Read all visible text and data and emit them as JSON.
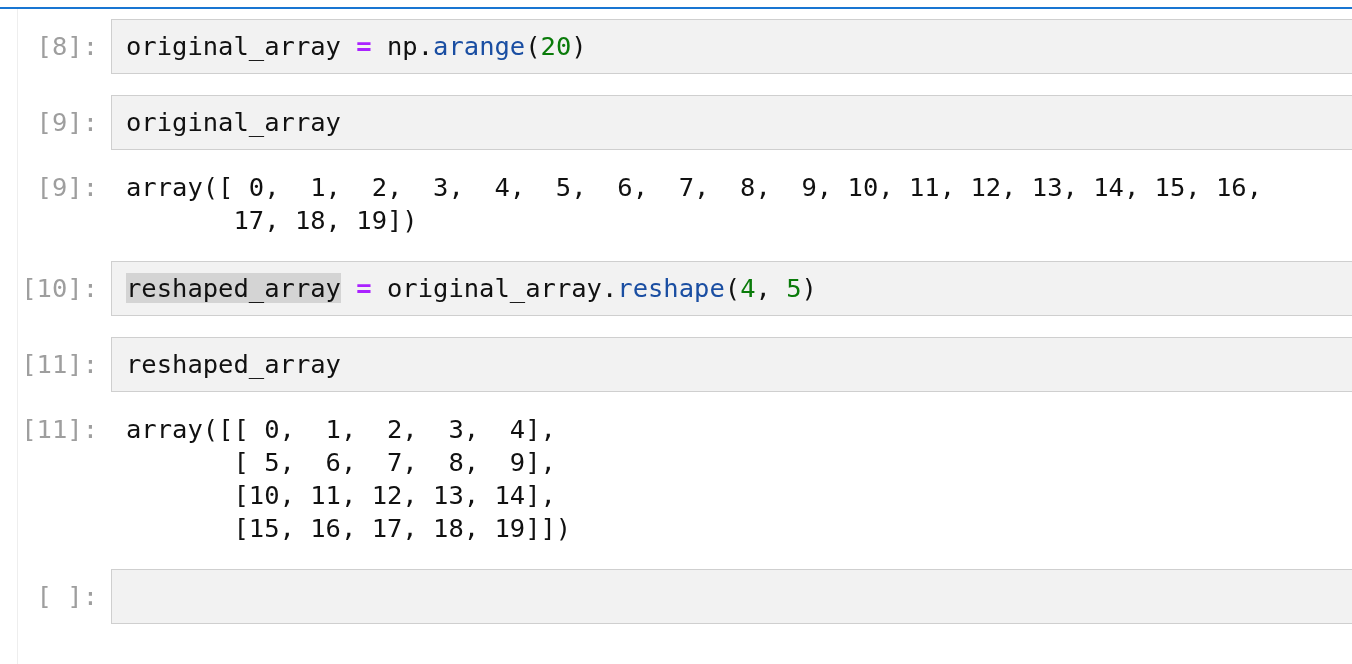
{
  "cells": [
    {
      "kind": "input",
      "prompt": "[8]:",
      "tokens": [
        {
          "text": "original_array",
          "kind": "name",
          "highlighted": false
        },
        {
          "text": " =",
          "kind": "op",
          "highlighted": false
        },
        {
          "text": " np.",
          "kind": "name",
          "highlighted": false
        },
        {
          "text": "arange",
          "kind": "func",
          "highlighted": false
        },
        {
          "text": "(",
          "kind": "name",
          "highlighted": false
        },
        {
          "text": "20",
          "kind": "num",
          "highlighted": false
        },
        {
          "text": ")",
          "kind": "name",
          "highlighted": false
        }
      ]
    },
    {
      "kind": "input",
      "prompt": "[9]:",
      "tokens": [
        {
          "text": "original_array",
          "kind": "name",
          "highlighted": false
        }
      ]
    },
    {
      "kind": "output",
      "prompt": "[9]:",
      "text": "array([ 0,  1,  2,  3,  4,  5,  6,  7,  8,  9, 10, 11, 12, 13, 14, 15, 16,\n       17, 18, 19])"
    },
    {
      "kind": "input",
      "prompt": "[10]:",
      "tokens": [
        {
          "text": "reshaped_array",
          "kind": "name",
          "highlighted": true
        },
        {
          "text": " =",
          "kind": "op",
          "highlighted": false
        },
        {
          "text": " original_array.",
          "kind": "name",
          "highlighted": false
        },
        {
          "text": "reshape",
          "kind": "func",
          "highlighted": false
        },
        {
          "text": "(",
          "kind": "name",
          "highlighted": false
        },
        {
          "text": "4",
          "kind": "num",
          "highlighted": false
        },
        {
          "text": ", ",
          "kind": "name",
          "highlighted": false
        },
        {
          "text": "5",
          "kind": "num",
          "highlighted": false
        },
        {
          "text": ")",
          "kind": "name",
          "highlighted": false
        }
      ]
    },
    {
      "kind": "input",
      "prompt": "[11]:",
      "tokens": [
        {
          "text": "reshaped_array",
          "kind": "name",
          "highlighted": false
        }
      ]
    },
    {
      "kind": "output",
      "prompt": "[11]:",
      "text": "array([[ 0,  1,  2,  3,  4],\n       [ 5,  6,  7,  8,  9],\n       [10, 11, 12, 13, 14],\n       [15, 16, 17, 18, 19]])"
    },
    {
      "kind": "input",
      "prompt": "[ ]:"
    }
  ]
}
